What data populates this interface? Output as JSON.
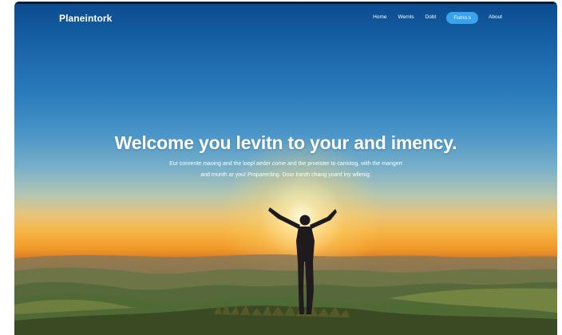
{
  "nav": {
    "logo": "Planeintork",
    "links": [
      "Home",
      "Wernls",
      "Dobt"
    ],
    "cta": "Fumo.s",
    "about": "About"
  },
  "hero": {
    "title": "Welcome you levitn to your and imency.",
    "subtitle_line1": "Eur conrente maoing and the loopl aeder come and the prneister to canistog, with the mangert",
    "subtitle_line2": "and rnunth ar you! Proparecting. Dour lranth chang yoard iny wllenig."
  },
  "colors": {
    "sky_top": "#0a4a8e",
    "sun": "#fff6d5",
    "horizon": "#f19a2a",
    "grass": "#3f5a2c",
    "cta_bg": "#3aa3f0"
  }
}
